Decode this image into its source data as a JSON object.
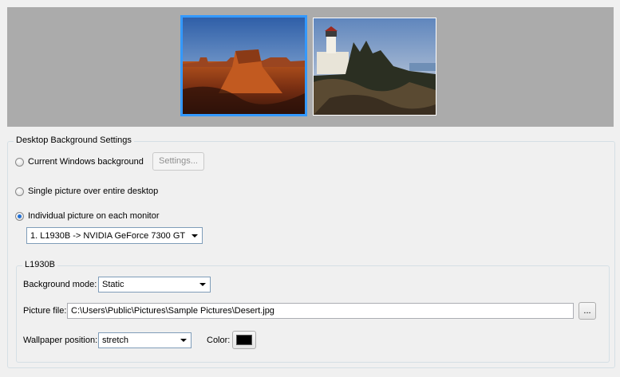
{
  "preview": {
    "monitors": [
      {
        "name": "monitor-1",
        "selected": true
      },
      {
        "name": "monitor-2",
        "selected": false
      }
    ]
  },
  "settings_group": {
    "title": "Desktop Background Settings",
    "options": {
      "current_windows": {
        "label": "Current Windows background",
        "checked": false
      },
      "single_picture": {
        "label": "Single picture over entire desktop",
        "checked": false
      },
      "individual_picture": {
        "label": "Individual picture on each monitor",
        "checked": true
      }
    },
    "settings_button": "Settings...",
    "monitor_select": "1. L1930B -> NVIDIA GeForce 7300 GT"
  },
  "monitor_group": {
    "title": "L1930B",
    "background_mode_label": "Background mode:",
    "background_mode_value": "Static",
    "picture_file_label": "Picture file:",
    "picture_file_value": "C:\\Users\\Public\\Pictures\\Sample Pictures\\Desert.jpg",
    "browse_button": "...",
    "wallpaper_position_label": "Wallpaper position:",
    "wallpaper_position_value": "stretch",
    "color_label": "Color:",
    "color_value": "#000000"
  }
}
